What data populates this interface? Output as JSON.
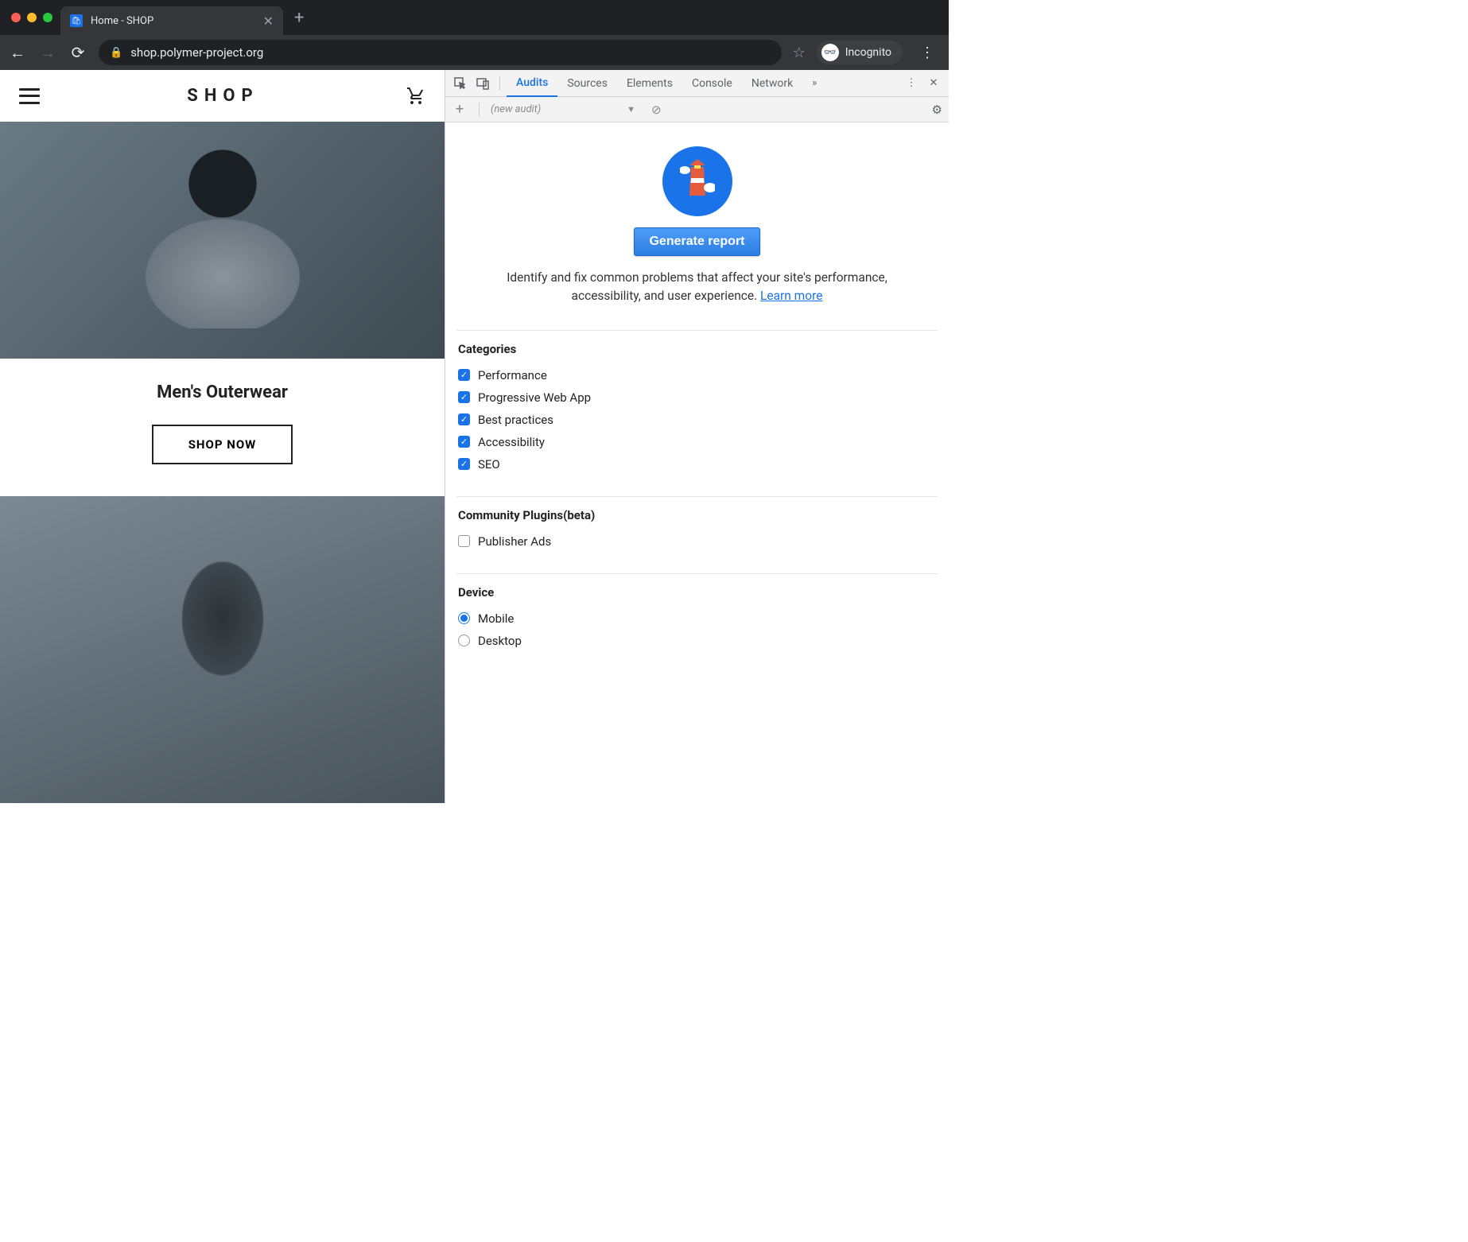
{
  "browser": {
    "tab_title": "Home - SHOP",
    "url": "shop.polymer-project.org",
    "incognito_label": "Incognito"
  },
  "site": {
    "title": "SHOP",
    "product_title": "Men's Outerwear",
    "shop_btn": "SHOP NOW"
  },
  "devtools": {
    "tabs": [
      "Audits",
      "Sources",
      "Elements",
      "Console",
      "Network"
    ],
    "active_tab": "Audits",
    "new_audit_label": "(new audit)",
    "generate_btn": "Generate report",
    "desc_prefix": "Identify and fix common problems that affect your site's performance, accessibility, and user experience. ",
    "learn_more": "Learn more",
    "categories_title": "Categories",
    "categories": [
      {
        "label": "Performance",
        "checked": true
      },
      {
        "label": "Progressive Web App",
        "checked": true
      },
      {
        "label": "Best practices",
        "checked": true
      },
      {
        "label": "Accessibility",
        "checked": true
      },
      {
        "label": "SEO",
        "checked": true
      }
    ],
    "plugins_title": "Community Plugins(beta)",
    "plugins": [
      {
        "label": "Publisher Ads",
        "checked": false
      }
    ],
    "device_title": "Device",
    "devices": [
      {
        "label": "Mobile",
        "checked": true
      },
      {
        "label": "Desktop",
        "checked": false
      }
    ]
  }
}
